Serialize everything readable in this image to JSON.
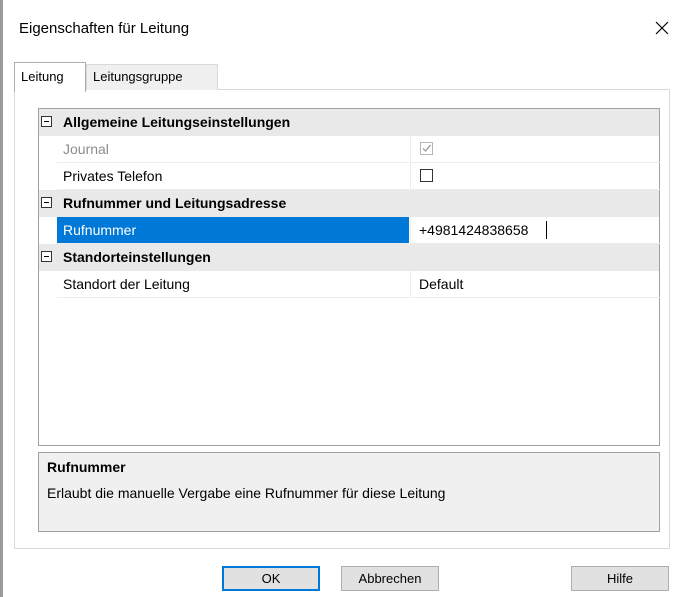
{
  "window": {
    "title": "Eigenschaften für Leitung",
    "close_icon": "close-icon"
  },
  "tabs": [
    {
      "label": "Leitung",
      "active": true
    },
    {
      "label": "Leitungsgruppe",
      "active": false
    }
  ],
  "grid": {
    "categories": [
      {
        "label": "Allgemeine Leitungseinstellungen",
        "properties": [
          {
            "name": "Journal",
            "type": "checkbox",
            "checked": true,
            "disabled": true
          },
          {
            "name": "Privates Telefon",
            "type": "checkbox",
            "checked": false,
            "disabled": false
          }
        ]
      },
      {
        "label": "Rufnummer und Leitungsadresse",
        "properties": [
          {
            "name": "Rufnummer",
            "type": "text",
            "value": "+4981424838658",
            "selected": true
          }
        ]
      },
      {
        "label": "Standorteinstellungen",
        "properties": [
          {
            "name": "Standort der Leitung",
            "type": "text",
            "value": "Default"
          }
        ]
      }
    ]
  },
  "description": {
    "title": "Rufnummer",
    "text": "Erlaubt die manuelle Vergabe eine Rufnummer für diese Leitung"
  },
  "buttons": {
    "ok": "OK",
    "cancel": "Abbrechen",
    "help": "Hilfe"
  },
  "colors": {
    "selection": "#0078d7",
    "category_bg": "#e9e9e9",
    "disabled_text": "#8c8c8c"
  }
}
